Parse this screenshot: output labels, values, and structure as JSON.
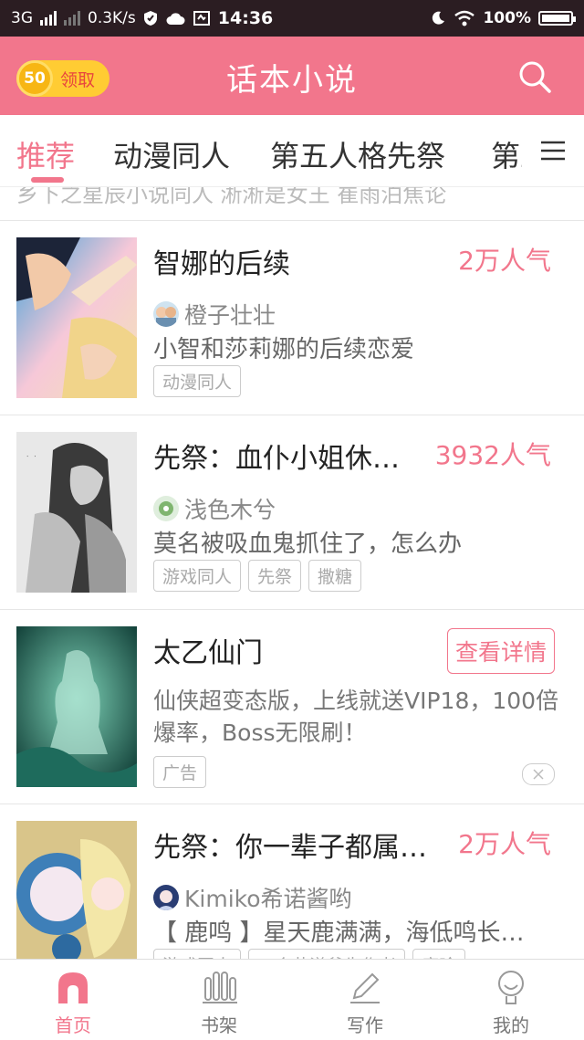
{
  "status_bar": {
    "network": "3G",
    "speed": "0.3K/s",
    "time": "14:36",
    "battery": "100%",
    "battery_level": 1.0,
    "icons": [
      "signal-icon",
      "shield-icon",
      "cloud-icon",
      "screenshot-icon",
      "moon-icon",
      "wifi-icon",
      "battery-icon"
    ]
  },
  "header": {
    "coins": "50",
    "claim_label": "领取",
    "title": "话本小说",
    "search_icon": "search-icon"
  },
  "tabs": [
    {
      "label": "推荐",
      "active": true
    },
    {
      "label": "动漫同人",
      "active": false
    },
    {
      "label": "第五人格先祭",
      "active": false
    },
    {
      "label": "第五",
      "active": false
    }
  ],
  "tabs_more_icon": "menu-icon",
  "previous_item_text": "乡下之星辰小说同人  淅淅是女王  崔雨泊焦论",
  "cards": [
    {
      "title": "智娜的后续",
      "popularity": "2万人气",
      "author": "橙子壮壮",
      "description": "小智和莎莉娜的后续恋爱",
      "tags": [
        "动漫同人"
      ]
    },
    {
      "title": "先祭：血仆小姐休…",
      "popularity": "3932人气",
      "author": "浅色木兮",
      "description": "莫名被吸血鬼抓住了，怎么办",
      "tags": [
        "游戏同人",
        "先祭",
        "撒糖"
      ]
    }
  ],
  "ad": {
    "title": "太乙仙门",
    "button": "查看详情",
    "description": "仙侠超变态版，上线就送VIP18，100倍爆率，Boss无限刷！",
    "tag": "广告"
  },
  "last_card": {
    "title": "先祭：你一辈子都属…",
    "popularity": "2万人气",
    "author": "Kimiko希诺酱哟",
    "description": "【 鹿鸣 】星天鹿满满，海低鸣长…",
    "tags": [
      "游戏同人",
      "一个花漾爷先作者",
      "鹿晗"
    ]
  },
  "bottom_nav": [
    {
      "label": "首页",
      "icon": "home-icon",
      "active": true
    },
    {
      "label": "书架",
      "icon": "bookshelf-icon",
      "active": false
    },
    {
      "label": "写作",
      "icon": "pen-icon",
      "active": false
    },
    {
      "label": "我的",
      "icon": "profile-icon",
      "active": false
    }
  ],
  "colors": {
    "accent": "#f2768c",
    "status_bar": "#2b1d22",
    "coin": "#ffcc33"
  }
}
